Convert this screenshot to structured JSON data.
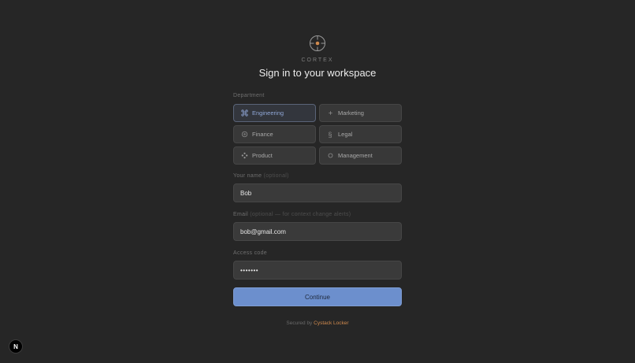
{
  "brand": {
    "name": "CORTEX",
    "logo_icon": "crosshair-logo-icon",
    "accent": "#d08a4e"
  },
  "title": "Sign in to your workspace",
  "department": {
    "label": "Department",
    "selected": "Engineering",
    "options": [
      {
        "label": "Engineering",
        "icon": "command-icon"
      },
      {
        "label": "Marketing",
        "icon": "plus-icon"
      },
      {
        "label": "Finance",
        "icon": "circle-icon"
      },
      {
        "label": "Legal",
        "icon": "section-icon"
      },
      {
        "label": "Product",
        "icon": "diamond-dots-icon"
      },
      {
        "label": "Management",
        "icon": "ring-icon"
      }
    ]
  },
  "name_field": {
    "label": "Your name",
    "hint": "(optional)",
    "value": "Bob"
  },
  "email_field": {
    "label": "Email",
    "hint": "(optional — for context change alerts)",
    "value": "bob@gmail.com"
  },
  "access_field": {
    "label": "Access code",
    "value": "•••••••"
  },
  "continue_label": "Continue",
  "footer": {
    "prefix": "Secured by",
    "link": "Cystack Locker"
  },
  "dev_badge": {
    "label": "N"
  },
  "colors": {
    "background": "#262626",
    "button": "#6c8fcd",
    "selected_accent": "#8fa6d6"
  }
}
